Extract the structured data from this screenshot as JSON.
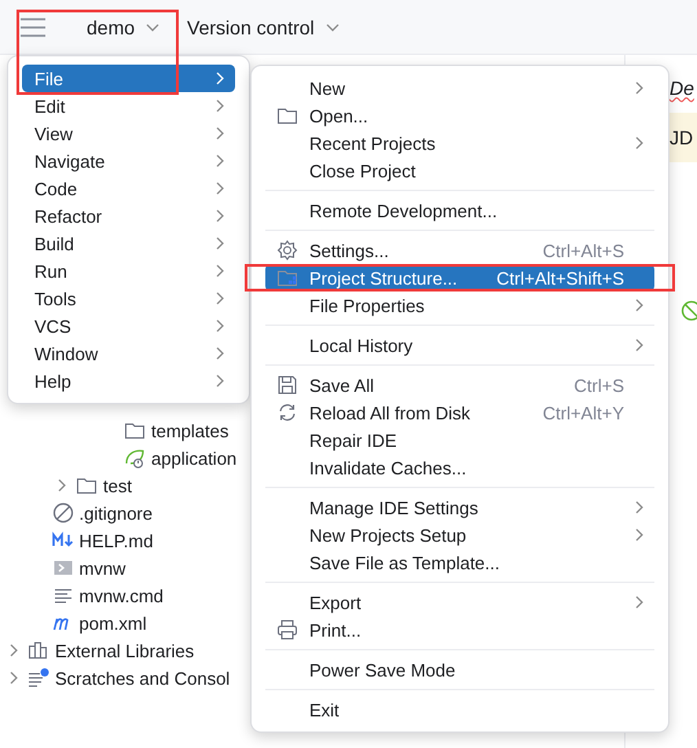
{
  "toolbar": {
    "main_menu_button": {
      "selected": false
    },
    "project": {
      "label": "demo"
    },
    "vcs": {
      "label": "Version control"
    }
  },
  "project_tree": [
    {
      "children": [
        {
          "children": [
            {
              "children": [
                {
                  "children": [
                    {
                      "label": "templates",
                      "kind": "folder"
                    },
                    {
                      "label": "application",
                      "kind": "spring-config"
                    }
                  ]
                }
              ]
            },
            {
              "label": "test",
              "kind": "folder",
              "expanded": false
            }
          ]
        },
        {
          "label": ".gitignore",
          "kind": "ignore"
        },
        {
          "label": "HELP.md",
          "kind": "markdown"
        },
        {
          "label": "mvnw",
          "kind": "script"
        },
        {
          "label": "mvnw.cmd",
          "kind": "text"
        },
        {
          "label": "pom.xml",
          "kind": "maven"
        }
      ]
    },
    {
      "label": "External Libraries",
      "kind": "libraries",
      "expanded": false
    },
    {
      "label": "Scratches and Consol",
      "kind": "scratches",
      "expanded": false
    }
  ],
  "editor": {
    "lines": [
      {
        "text": "De",
        "kind": "misspelled"
      },
      {
        "text": "JD",
        "kind": "highlighted"
      }
    ]
  },
  "main_menu": {
    "items": [
      {
        "label": "File",
        "selected": true,
        "submenu": true
      },
      {
        "label": "Edit",
        "selected": false,
        "submenu": true
      },
      {
        "label": "View",
        "selected": false,
        "submenu": true
      },
      {
        "label": "Navigate",
        "selected": false,
        "submenu": true
      },
      {
        "label": "Code",
        "selected": false,
        "submenu": true
      },
      {
        "label": "Refactor",
        "selected": false,
        "submenu": true
      },
      {
        "label": "Build",
        "selected": false,
        "submenu": true
      },
      {
        "label": "Run",
        "selected": false,
        "submenu": true
      },
      {
        "label": "Tools",
        "selected": false,
        "submenu": true
      },
      {
        "label": "VCS",
        "selected": false,
        "submenu": true
      },
      {
        "label": "Window",
        "selected": false,
        "submenu": true
      },
      {
        "label": "Help",
        "selected": false,
        "submenu": true
      }
    ]
  },
  "file_menu": {
    "items": [
      {
        "kind": "item",
        "label": "New",
        "selected": false,
        "submenu": true
      },
      {
        "kind": "folder",
        "label": "Open...",
        "selected": false,
        "submenu": false
      },
      {
        "kind": "item",
        "label": "Recent Projects",
        "selected": false,
        "submenu": true
      },
      {
        "kind": "item",
        "label": "Close Project",
        "selected": false,
        "submenu": false
      },
      {
        "kind": "separator"
      },
      {
        "kind": "item",
        "label": "Remote Development...",
        "selected": false,
        "submenu": false
      },
      {
        "kind": "separator"
      },
      {
        "kind": "gear",
        "label": "Settings...",
        "shortcut": "Ctrl+Alt+S",
        "selected": false,
        "submenu": false
      },
      {
        "kind": "project-structure",
        "label": "Project Structure...",
        "shortcut": "Ctrl+Alt+Shift+S",
        "selected": true,
        "submenu": false
      },
      {
        "kind": "item",
        "label": "File Properties",
        "selected": false,
        "submenu": true
      },
      {
        "kind": "separator"
      },
      {
        "kind": "item",
        "label": "Local History",
        "selected": false,
        "submenu": true
      },
      {
        "kind": "separator"
      },
      {
        "kind": "floppy",
        "label": "Save All",
        "shortcut": "Ctrl+S",
        "selected": false,
        "submenu": false
      },
      {
        "kind": "reload",
        "label": "Reload All from Disk",
        "shortcut": "Ctrl+Alt+Y",
        "selected": false,
        "submenu": false
      },
      {
        "kind": "item",
        "label": "Repair IDE",
        "selected": false,
        "submenu": false
      },
      {
        "kind": "item",
        "label": "Invalidate Caches...",
        "selected": false,
        "submenu": false
      },
      {
        "kind": "separator"
      },
      {
        "kind": "item",
        "label": "Manage IDE Settings",
        "selected": false,
        "submenu": true
      },
      {
        "kind": "item",
        "label": "New Projects Setup",
        "selected": false,
        "submenu": true
      },
      {
        "kind": "item",
        "label": "Save File as Template...",
        "selected": false,
        "submenu": false
      },
      {
        "kind": "separator"
      },
      {
        "kind": "item",
        "label": "Export",
        "selected": false,
        "submenu": true
      },
      {
        "kind": "printer",
        "label": "Print...",
        "selected": false,
        "submenu": false
      },
      {
        "kind": "separator"
      },
      {
        "kind": "item",
        "label": "Power Save Mode",
        "selected": false,
        "submenu": false
      },
      {
        "kind": "separator"
      },
      {
        "kind": "item",
        "label": "Exit",
        "selected": false,
        "submenu": false
      }
    ]
  },
  "annotations": [
    {
      "kind": "frame"
    },
    {
      "kind": "frame"
    }
  ]
}
